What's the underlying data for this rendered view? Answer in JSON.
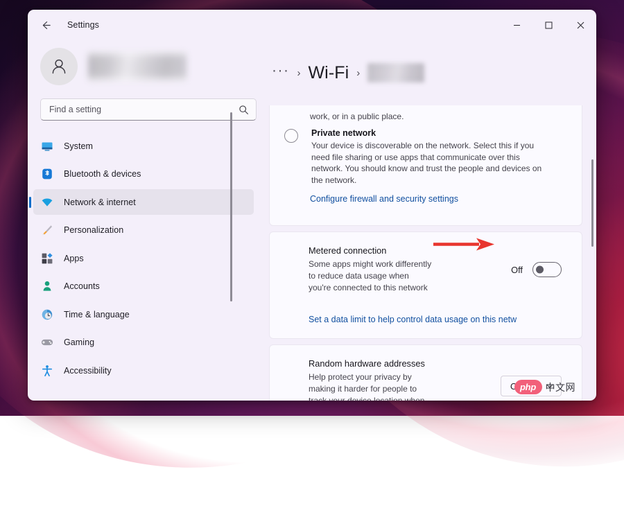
{
  "window": {
    "title": "Settings",
    "back_icon": "back-arrow-icon",
    "controls": {
      "minimize": "minimize-icon",
      "maximize": "maximize-icon",
      "close": "close-icon"
    }
  },
  "sidebar": {
    "account": {
      "avatar_icon": "person-avatar-icon",
      "name_redacted": ""
    },
    "search": {
      "placeholder": "Find a setting",
      "value": "",
      "icon": "search-icon"
    },
    "items": [
      {
        "label": "System",
        "icon": "monitor-icon",
        "active": false
      },
      {
        "label": "Bluetooth & devices",
        "icon": "bluetooth-icon",
        "active": false
      },
      {
        "label": "Network & internet",
        "icon": "wifi-icon",
        "active": true
      },
      {
        "label": "Personalization",
        "icon": "paintbrush-icon",
        "active": false
      },
      {
        "label": "Apps",
        "icon": "apps-grid-icon",
        "active": false
      },
      {
        "label": "Accounts",
        "icon": "account-person-icon",
        "active": false
      },
      {
        "label": "Time & language",
        "icon": "clock-globe-icon",
        "active": false
      },
      {
        "label": "Gaming",
        "icon": "gamepad-icon",
        "active": false
      },
      {
        "label": "Accessibility",
        "icon": "accessibility-person-icon",
        "active": false
      }
    ]
  },
  "breadcrumb": {
    "overflow": "···",
    "separator": "›",
    "current": "Wi-Fi",
    "network_redacted": ""
  },
  "main": {
    "network_profile_card": {
      "clipped_text": "work, or in a public place.",
      "private_network": {
        "title": "Private network",
        "description": "Your device is discoverable on the network. Select this if you need file sharing or use apps that communicate over this network. You should know and trust the people and devices on the network.",
        "selected": false
      },
      "firewall_link": "Configure firewall and security settings"
    },
    "metered_connection": {
      "title": "Metered connection",
      "description": "Some apps might work differently to reduce data usage when you're connected to this network",
      "toggle_state_label": "Off",
      "toggle_on": false,
      "data_limit_link": "Set a data limit to help control data usage on this netw"
    },
    "random_hardware_addresses": {
      "title": "Random hardware addresses",
      "description": "Help protect your privacy by making it harder for people to track your device location when you connect to this network. The setting takes effect the next time you connect to this network.",
      "dropdown_value": "On",
      "dropdown_icon": "chevron-down-icon"
    }
  },
  "annotation": {
    "arrow_color": "#e8352e",
    "arrow_icon": "red-arrow-right-icon",
    "points_to": "metered-connection-toggle"
  },
  "watermark": {
    "badge_text": "php",
    "suffix_text": "中文网",
    "badge_color": "#f2607a"
  }
}
